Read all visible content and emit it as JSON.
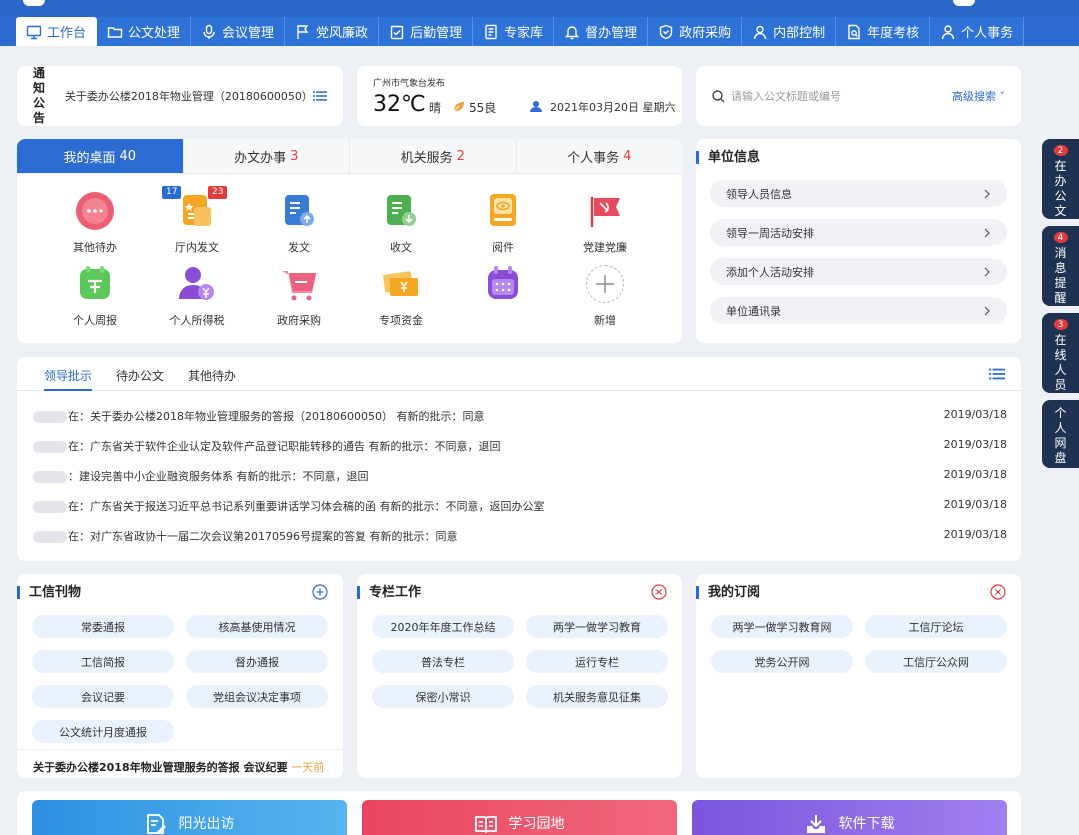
{
  "nav": {
    "items": [
      {
        "label": "工作台",
        "icon": "monitor-icon",
        "active": true
      },
      {
        "label": "公文处理",
        "icon": "folder-icon"
      },
      {
        "label": "会议管理",
        "icon": "microphone-icon"
      },
      {
        "label": "党风廉政",
        "icon": "flag-icon"
      },
      {
        "label": "后勤管理",
        "icon": "clipboard-check-icon"
      },
      {
        "label": "专家库",
        "icon": "document-list-icon"
      },
      {
        "label": "督办管理",
        "icon": "bell-icon"
      },
      {
        "label": "政府采购",
        "icon": "shield-icon"
      },
      {
        "label": "内部控制",
        "icon": "user-icon"
      },
      {
        "label": "年度考核",
        "icon": "file-search-icon"
      },
      {
        "label": "个人事务",
        "icon": "person-icon"
      }
    ]
  },
  "notice": {
    "tag": "通知公告",
    "text": "关于委办公楼2018年物业管理（20180600050）"
  },
  "weather": {
    "source": "广州市气象台发布",
    "temp": "32℃",
    "condition": "晴",
    "aqi": "55良",
    "date": "2021年03月20日 星期六"
  },
  "search": {
    "placeholder": "请输入公文标题或编号",
    "advanced": "高级搜索 ˅"
  },
  "desk": {
    "tabs": [
      {
        "label": "我的桌面",
        "count": "40",
        "active": true
      },
      {
        "label": "办文办事",
        "count": "3"
      },
      {
        "label": "机关服务",
        "count": "2"
      },
      {
        "label": "个人事务",
        "count": "4"
      }
    ],
    "apps": [
      {
        "label": "其他待办",
        "icon": "dots-icon",
        "color": "#e84a5f"
      },
      {
        "label": "厅内发文",
        "icon": "doc-star-icon",
        "color": "#f5a623",
        "badge_left": "17",
        "badge_right": "23"
      },
      {
        "label": "发文",
        "icon": "doc-upload-icon",
        "color": "#3a7bd5"
      },
      {
        "label": "收文",
        "icon": "doc-download-icon",
        "color": "#4caf50"
      },
      {
        "label": "阅件",
        "icon": "eye-icon",
        "color": "#f5a623"
      },
      {
        "label": "党建党廉",
        "icon": "party-flag-icon",
        "color": "#e84a5f"
      },
      {
        "label": "个人周报",
        "icon": "weekly-report-icon",
        "color": "#5cc85c"
      },
      {
        "label": "个人所得税",
        "icon": "user-yuan-icon",
        "color": "#8a4dd6"
      },
      {
        "label": "政府采购",
        "icon": "cart-icon",
        "color": "#ec6080"
      },
      {
        "label": "专项资金",
        "icon": "money-icon",
        "color": "#f5b94a"
      },
      {
        "label": "",
        "icon": "calendar-icon",
        "color": "#8a4dd6"
      },
      {
        "label": "新增",
        "icon": "plus-icon",
        "color": "#999999"
      }
    ]
  },
  "unit": {
    "title": "单位信息",
    "items": [
      "领导人员信息",
      "领导一周活动安排",
      "添加个人活动安排",
      "单位通讯录"
    ]
  },
  "leader": {
    "tabs": [
      "领导批示",
      "待办公文",
      "其他待办"
    ],
    "rows": [
      {
        "text": "在：关于委办公楼2018年物业管理服务的答报（20180600050）   有新的批示：同意",
        "date": "2019/03/18"
      },
      {
        "text": "在：广东省关于软件企业认定及软件产品登记职能转移的通告   有新的批示：不同意，退回",
        "date": "2019/03/18"
      },
      {
        "text": "：建设完善中小企业融资服务体系   有新的批示：不同意，退回",
        "date": "2019/03/18"
      },
      {
        "text": "在：广东省关于报送习近平总书记系列重要讲话学习体会稿的函   有新的批示：不同意，返回办公室",
        "date": "2019/03/18"
      },
      {
        "text": "在：对广东省政协十一届二次会议第20170596号提案的答复   有新的批示：同意",
        "date": "2019/03/18"
      }
    ]
  },
  "magazine": {
    "title": "工信刊物",
    "items": [
      "常委通报",
      "核高基使用情况",
      "工信简报",
      "督办通报",
      "会议记要",
      "党组会议决定事项",
      "公文统计月度通报"
    ],
    "footer": "关于委办公楼2018年物业管理服务的答报 会议纪要",
    "footer_time": "一天前"
  },
  "column": {
    "title": "专栏工作",
    "items": [
      "2020年年度工作总结",
      "两学一做学习教育",
      "普法专栏",
      "运行专栏",
      "保密小常识",
      "机关服务意见征集"
    ]
  },
  "subscribe": {
    "title": "我的订阅",
    "items": [
      "两学一做学习教育网",
      "工信厅论坛",
      "党务公开网",
      "工信厅公众网"
    ]
  },
  "banners": [
    {
      "label": "阳光出访",
      "icon": "pen-doc-icon",
      "color": "#3aa0e6"
    },
    {
      "label": "学习园地",
      "icon": "book-icon",
      "color": "#ec5264"
    },
    {
      "label": "软件下载",
      "icon": "download-tray-icon",
      "color": "#8b62e0"
    }
  ],
  "float": [
    {
      "count": "2",
      "label": "在办公文"
    },
    {
      "count": "4",
      "label": "消息提醒"
    },
    {
      "count": "3",
      "label": "在线人员"
    },
    {
      "label": "个人网盘"
    }
  ]
}
